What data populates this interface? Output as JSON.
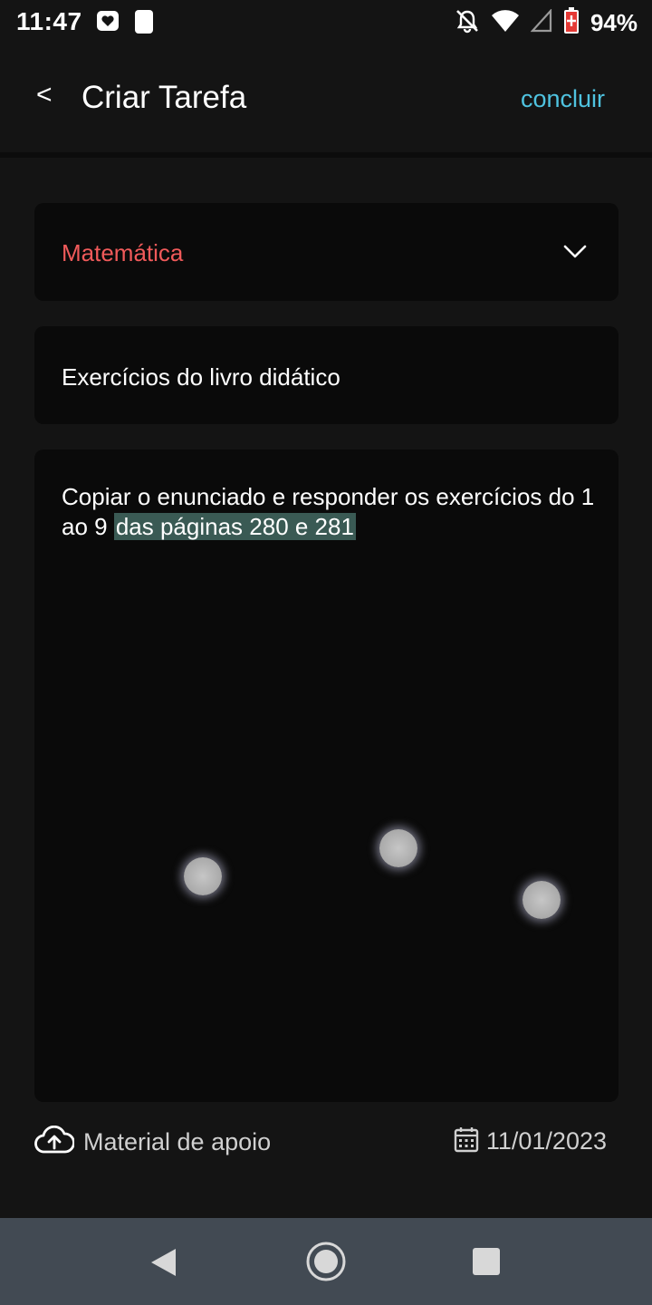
{
  "status_bar": {
    "time": "11:47",
    "battery": "94%",
    "icons": [
      "heart-notification-icon",
      "moon-notification-icon",
      "bell-off-icon",
      "wifi-icon",
      "signal-icon",
      "battery-icon"
    ]
  },
  "header": {
    "back_label": "<",
    "title": "Criar Tarefa",
    "done_label": "concluir"
  },
  "form": {
    "subject": "Matemática",
    "task_title": "Exercícios do livro didático",
    "description_plain": "Copiar o enunciado e responder os exercícios do 1 ao 9 ",
    "description_selected": "das páginas 280 e 281"
  },
  "footer": {
    "support_material": "Material de apoio",
    "due_date": "11/01/2023"
  },
  "colors": {
    "background": "#141414",
    "card": "#0a0a0a",
    "accent": "#4fc3e0",
    "subject": "#f05a5a",
    "selection": "#3a5a54",
    "nav_bar": "#424a53"
  }
}
